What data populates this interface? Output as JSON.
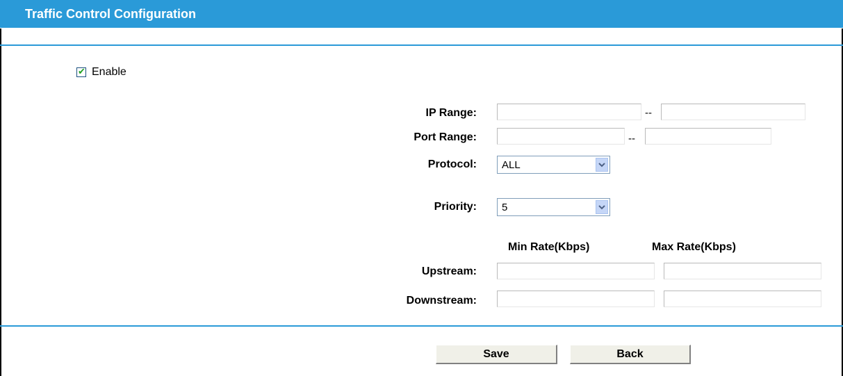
{
  "header": {
    "title": "Traffic Control Configuration"
  },
  "enable": {
    "label": "Enable",
    "checked": true
  },
  "form": {
    "ip_range": {
      "label": "IP Range:",
      "separator": "--",
      "from": "",
      "to": ""
    },
    "port_range": {
      "label": "Port Range:",
      "separator": "--",
      "from": "",
      "to": ""
    },
    "protocol": {
      "label": "Protocol:",
      "value": "ALL"
    },
    "priority": {
      "label": "Priority:",
      "value": "5"
    },
    "rates": {
      "min_header": "Min Rate(Kbps)",
      "max_header": "Max Rate(Kbps)",
      "upstream": {
        "label": "Upstream:",
        "min": "",
        "max": ""
      },
      "downstream": {
        "label": "Downstream:",
        "min": "",
        "max": ""
      }
    }
  },
  "buttons": {
    "save": "Save",
    "back": "Back"
  },
  "colors": {
    "accent": "#2a9ad8",
    "title_text": "#ffffff"
  }
}
